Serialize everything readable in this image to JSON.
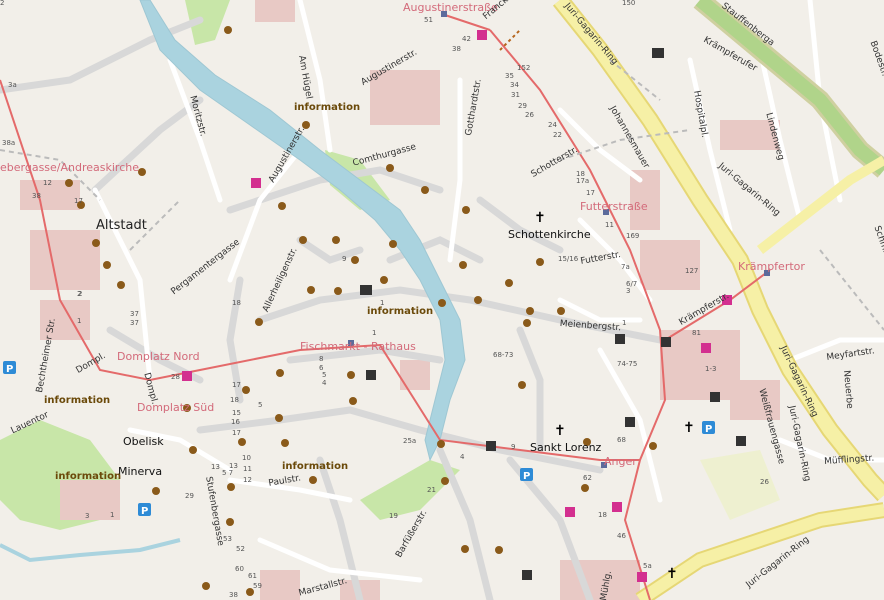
{
  "colors": {
    "background": "#f2efe9",
    "road_minor": "#ffffff",
    "road_pedestrian": "#d8d8d8",
    "ring_road": "#f6f0a6",
    "water": "#aad3df",
    "park": "#c8e6a8",
    "building": "#e8c9c5",
    "rail_red": "#e46a6a",
    "label_pink": "#d36a7a",
    "info_brown": "#6b4a0a"
  },
  "places": {
    "altstadt": "Altstadt",
    "schottenkirche": "Schottenkirche",
    "sankt_lorenz": "Sankt Lorenz",
    "obelisk": "Obelisk",
    "minerva": "Minerva"
  },
  "transit_stops": {
    "augustinerstrasse": "Augustinerstraße",
    "futterstrasse": "Futterstraße",
    "kraempfertor": "Krämpfertor",
    "fischmarkt_rathaus": "Fischmarkt - Rathaus",
    "domplatz_nord": "Domplatz Nord",
    "domplatz_sued": "Domplatz Süd",
    "anger": "Anger",
    "predigergasse": "ebergasse/Andreaskirche"
  },
  "info_label": "information",
  "streets": {
    "augustinerstr": "Augustinerstr.",
    "am_huegel": "Am Hügel",
    "moritzstr": "Moritzstr.",
    "comthurgasse": "Comthurgasse",
    "augustinerstr2": "Augustinerstr.",
    "gotthardtstr": "Gotthardtstr.",
    "schotterstr": "Schotterstr.",
    "futterstr": "Futterstr.",
    "meienbergstr": "Meienbergstr.",
    "pergamentergasse": "Pergamentergasse",
    "allerheiligenstr": "Allerheiligenstr.",
    "juri_gagarin_ring_top": "Juri-Gagarin-Ring",
    "juri_gagarin_ring_mid": "Juri-Gagarin-Ring",
    "juri_gagarin_ring_right": "Juri-Gagarin-Ring",
    "juri_gagarin_ring_bottom": "Juri-Gagarin-Ring",
    "juri_gagarin_ring_east": "Juri-Gagarin-Ring",
    "staufenberga": "Stauffenberga",
    "johannesmauer": "Johannesmauer",
    "hospitalpl": "Hospitalpl.",
    "lindenweg": "Lindenweg",
    "kraempferufer": "Krämpferufer",
    "kraempferstr": "Krämpferstr.",
    "meyfartstr": "Meyfartstr.",
    "neuerbe": "Neuerbe",
    "muefflingstr": "Müfflingstr.",
    "weissfrauengasse": "Weißfrauengasse",
    "schmidtstedter": "Schmidtst.",
    "bodestr": "Bodestr.",
    "paulstr": "Paulstr.",
    "stuerbergasse": "Stufenbergasse",
    "marstallstr": "Marstallstr.",
    "barfuesserstr": "Barfüßerstr.",
    "muehlgasse": "Mühlg.",
    "lauentor": "Lauentor",
    "bechtheimer_str": "Bechtheimer Str.",
    "dompl": "Dompl.",
    "dompl2": "Dompl.",
    "franckestr": "Francke"
  },
  "house_numbers": [
    "150",
    "51",
    "42",
    "38",
    "152",
    "35",
    "34",
    "31",
    "29",
    "26",
    "24",
    "22",
    "18",
    "17a",
    "17",
    "11",
    "169",
    "15/16",
    "7a",
    "6/7",
    "3",
    "81",
    "127",
    "1",
    "1",
    "2",
    "68-73",
    "74-75",
    "1-3",
    "26",
    "68",
    "46",
    "18",
    "62",
    "5a",
    "9",
    "25a",
    "4",
    "21",
    "19",
    "17",
    "18",
    "15",
    "13",
    "13",
    "5 7",
    "10",
    "11",
    "12",
    "28",
    "16",
    "17",
    "53",
    "52",
    "60",
    "61",
    "59",
    "38",
    "3a",
    "38a",
    "38",
    "12",
    "17",
    "37",
    "37",
    "2",
    "1",
    "9",
    "18",
    "5",
    "8",
    "6",
    "5",
    "4",
    "1",
    "29",
    "3",
    "1",
    "2"
  ]
}
